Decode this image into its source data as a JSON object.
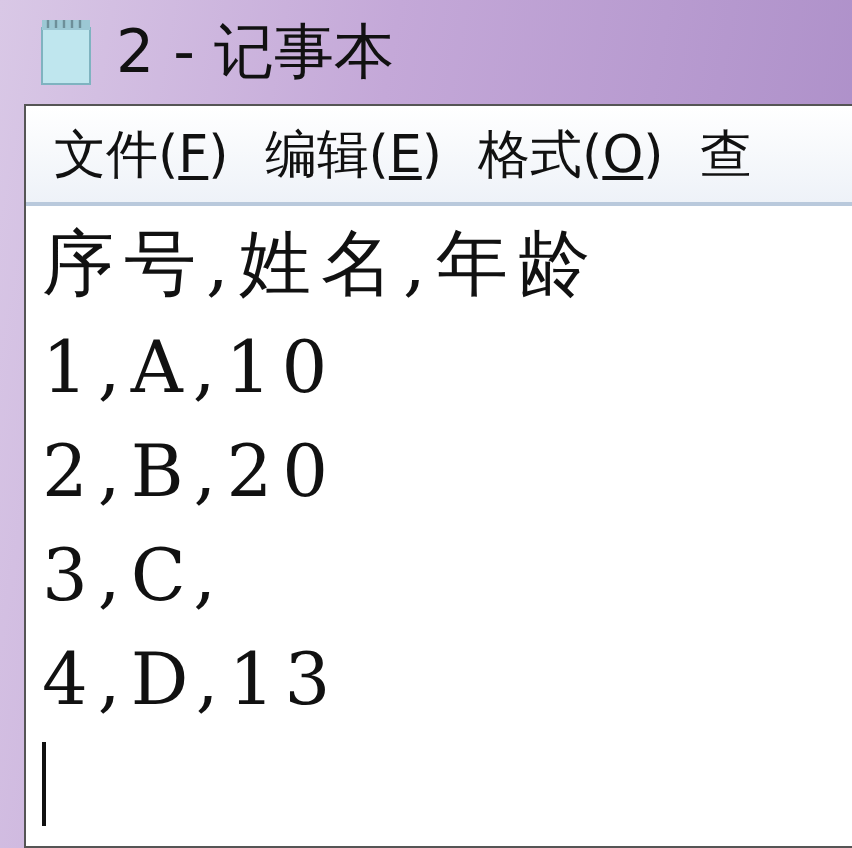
{
  "window": {
    "title": "2 - 记事本"
  },
  "menu": [
    {
      "label": "文件(",
      "key": "F",
      "tail": ")"
    },
    {
      "label": "编辑(",
      "key": "E",
      "tail": ")"
    },
    {
      "label": "格式(",
      "key": "O",
      "tail": ")"
    },
    {
      "label": "查"
    }
  ],
  "editor": {
    "lines": [
      "序号,姓名,年龄",
      "1,A,10",
      "2,B,20",
      "3,C,",
      "4,D,13"
    ],
    "caret": true
  }
}
